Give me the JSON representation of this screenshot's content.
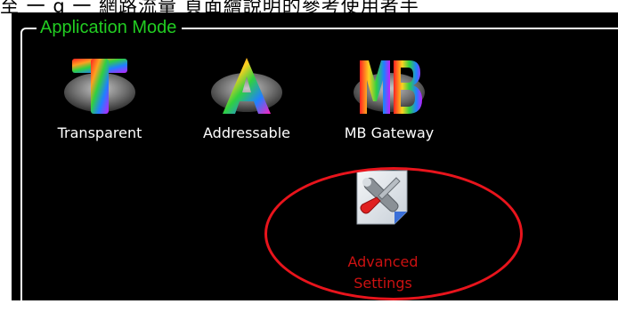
{
  "overlay_text": "至 一 g 一 網路流量 頁面繪說明的參考使用者手",
  "group": {
    "title": "Application Mode"
  },
  "modes": [
    {
      "label": "Transparent",
      "icon": "transparent-t-icon"
    },
    {
      "label": "Addressable",
      "icon": "addressable-a-icon"
    },
    {
      "label": "MB Gateway",
      "icon": "mb-gateway-icon"
    }
  ],
  "advanced": {
    "label_line1": "Advanced",
    "label_line2": "Settings",
    "icon": "wrench-screwdriver-icon"
  },
  "colors": {
    "panel": "#000000",
    "group_title": "#22cc22",
    "advanced_label": "#cc1111",
    "highlight": "#e8141c",
    "label": "#ffffff"
  }
}
